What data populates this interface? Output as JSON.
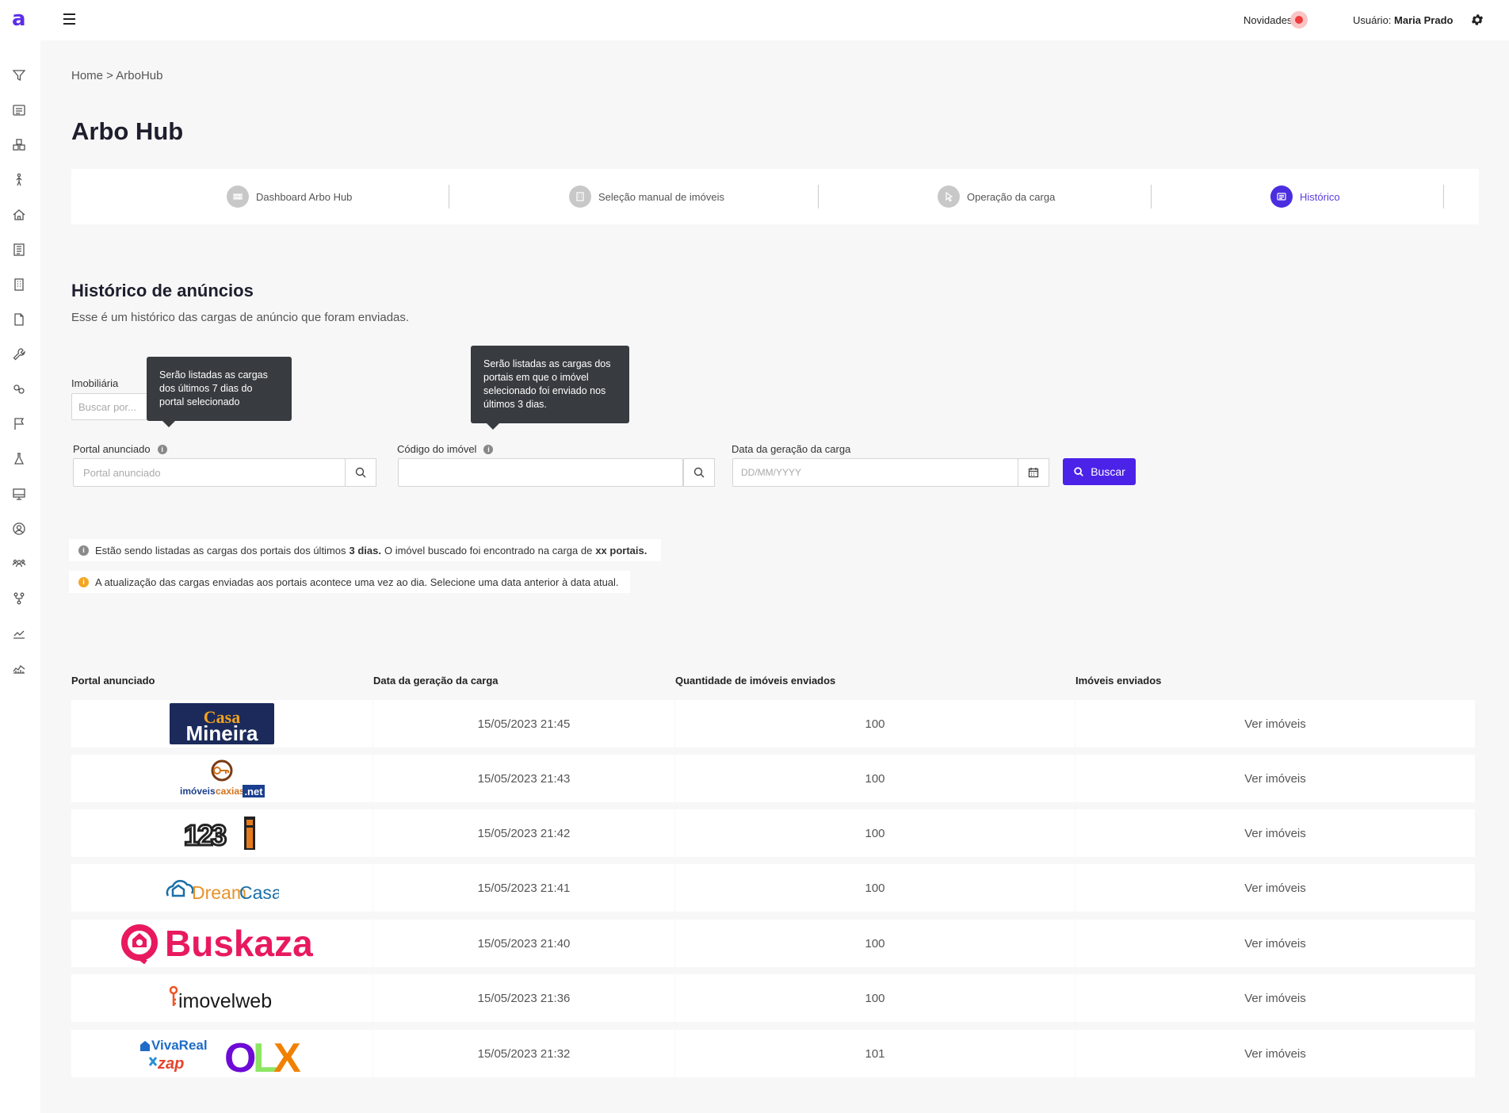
{
  "app": {
    "logo": "a"
  },
  "header": {
    "novidades": "Novidades",
    "usuario_label": "Usuário:",
    "usuario_name": "Maria Prado"
  },
  "sidebar_icons": [
    "filter-icon",
    "list-icon",
    "boxes-icon",
    "person-walking-icon",
    "home-icon",
    "newspaper-icon",
    "building-icon",
    "file-icon",
    "wrench-icon",
    "link-icon",
    "flag-icon",
    "flask-icon",
    "monitor-icon",
    "user-circle-icon",
    "users-icon",
    "fork-icon",
    "chart-line-icon",
    "chart-area-icon"
  ],
  "breadcrumb": "Home > ArboHub",
  "page_title": "Arbo Hub",
  "tabs": [
    {
      "label": "Dashboard Arbo Hub",
      "icon": "dashboard-icon"
    },
    {
      "label": "Seleção manual de imóveis",
      "icon": "building-icon"
    },
    {
      "label": "Operação da carga",
      "icon": "cursor-icon"
    },
    {
      "label": "Histórico",
      "icon": "list-icon",
      "active": true
    }
  ],
  "section": {
    "title": "Histórico de anúncios",
    "subtitle": "Esse é um histórico das cargas de anúncio que foram enviadas."
  },
  "filters": {
    "imobiliaria_label": "Imobiliária",
    "imobiliaria_placeholder": "Buscar por...",
    "portal_label": "Portal anunciado",
    "portal_placeholder": "Portal anunciado",
    "codigo_label": "Código do imóvel",
    "codigo_value": "",
    "data_label": "Data da geração da carga",
    "data_placeholder": "DD/MM/YYYY",
    "buscar": "Buscar"
  },
  "tooltips": {
    "portal": "Serão listadas as cargas dos últimos 7 dias do portal selecionado",
    "codigo": "Serão listadas as cargas dos portais em que o imóvel selecionado foi enviado nos últimos 3 dias."
  },
  "notices": {
    "n1_a": "Estão sendo listadas as cargas dos portais dos últimos",
    "n1_b": "3 dias.",
    "n1_c": "O imóvel buscado foi encontrado na carga de",
    "n1_d": "xx portais.",
    "n2": "A atualização das cargas enviadas aos portais acontece uma vez ao dia. Selecione uma data anterior à data atual.",
    "info_color": "#8a8a8a",
    "warn_color": "#f5a623"
  },
  "table": {
    "headers": [
      "Portal anunciado",
      "Data da geração da carga",
      "Quantidade de imóveis enviados",
      "Imóveis enviados"
    ],
    "rows": [
      {
        "portal": "Casa Mineira",
        "date": "15/05/2023 21:45",
        "qty": "100",
        "action": "Ver imóveis"
      },
      {
        "portal": "imóveiscaxias.net",
        "date": "15/05/2023 21:43",
        "qty": "100",
        "action": "Ver imóveis"
      },
      {
        "portal": "123i",
        "date": "15/05/2023 21:42",
        "qty": "100",
        "action": "Ver imóveis"
      },
      {
        "portal": "DreamCasa",
        "date": "15/05/2023 21:41",
        "qty": "100",
        "action": "Ver imóveis"
      },
      {
        "portal": "Buskaza",
        "date": "15/05/2023 21:40",
        "qty": "100",
        "action": "Ver imóveis"
      },
      {
        "portal": "imovelweb",
        "date": "15/05/2023 21:36",
        "qty": "100",
        "action": "Ver imóveis"
      },
      {
        "portal": "VivaReal zap OLX",
        "date": "15/05/2023 21:32",
        "qty": "101",
        "action": "Ver imóveis"
      }
    ]
  },
  "colors": {
    "accent": "#4b22e8",
    "active_tab": "#5b3de0"
  }
}
